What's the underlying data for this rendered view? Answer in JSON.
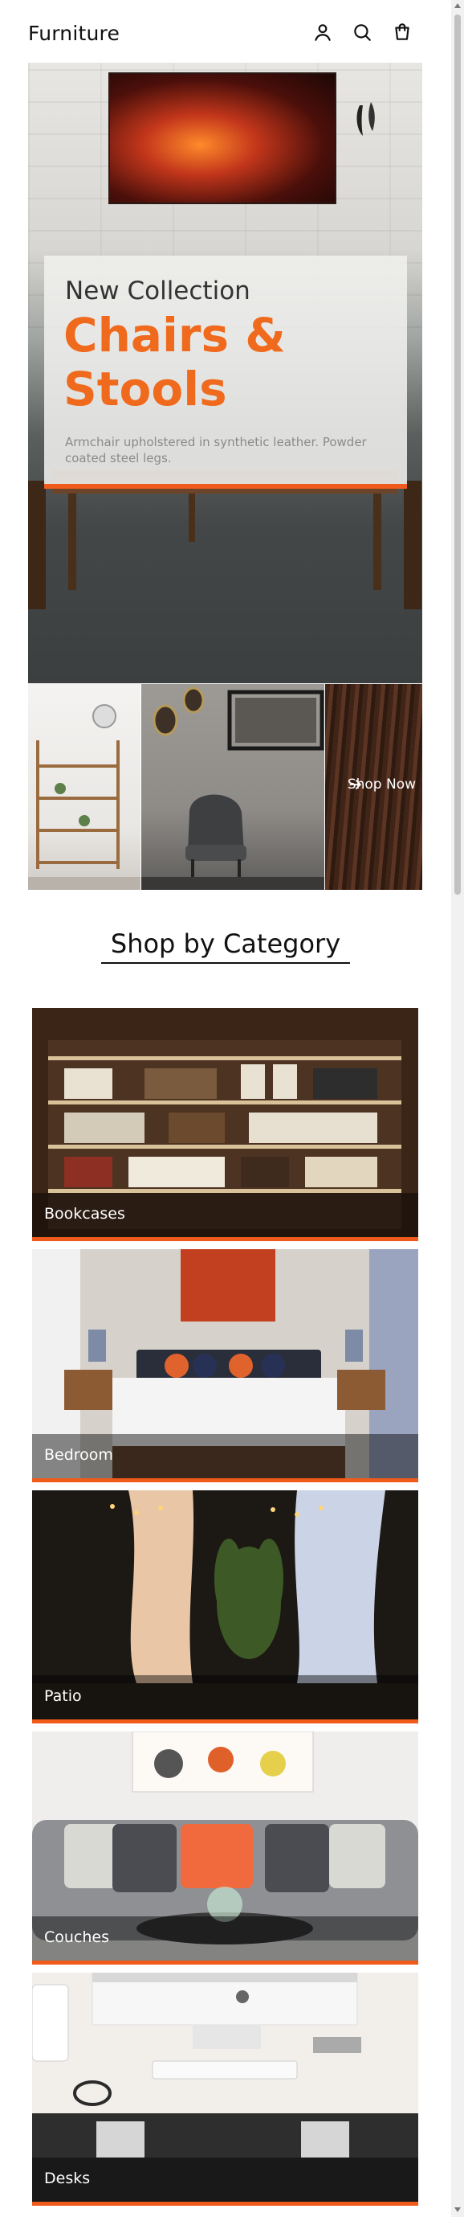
{
  "header": {
    "brand": "Furniture",
    "icons": [
      "account-icon",
      "search-icon",
      "cart-icon"
    ]
  },
  "hero": {
    "eyebrow": "New Collection",
    "title": "Chairs & Stools",
    "description": "Armchair upholstered in synthetic leather. Powder coated steel legs."
  },
  "promo_tiles": {
    "cta_label": "Shop Now"
  },
  "category_section": {
    "title": "Shop by Category",
    "items": [
      {
        "label": "Bookcases"
      },
      {
        "label": "Bedroom"
      },
      {
        "label": "Patio"
      },
      {
        "label": "Couches"
      },
      {
        "label": "Desks"
      }
    ]
  },
  "colors": {
    "accent": "#f05a1b",
    "text": "#111111"
  }
}
